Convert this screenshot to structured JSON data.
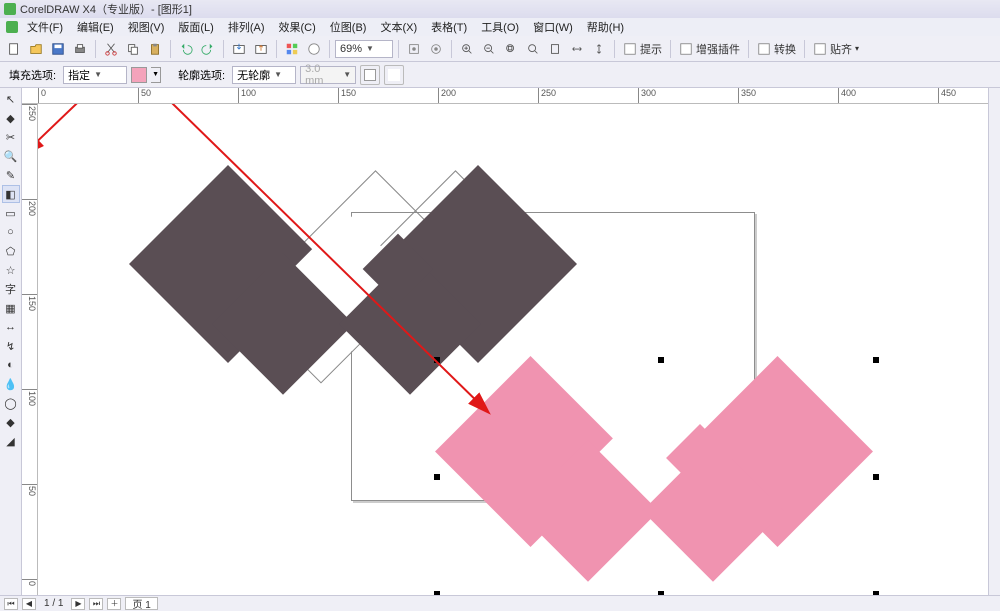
{
  "app": {
    "title": "CorelDRAW X4（专业版）- [图形1]"
  },
  "menu": {
    "file": "文件(F)",
    "edit": "编辑(E)",
    "view": "视图(V)",
    "layout": "版面(L)",
    "arrange": "排列(A)",
    "effects": "效果(C)",
    "bitmaps": "位图(B)",
    "text": "文本(X)",
    "table": "表格(T)",
    "tools": "工具(O)",
    "window": "窗口(W)",
    "help": "帮助(H)"
  },
  "toolbar1": {
    "zoom_value": "69%",
    "group_hints": "提示",
    "group_enhplugin": "增强插件",
    "group_convert": "转换",
    "group_align": "贴齐"
  },
  "propbar": {
    "fill_label": "填充选项:",
    "fill_option": "指定",
    "outline_label": "轮廓选项:",
    "outline_option": "无轮廓",
    "outline_width": "3.0 mm"
  },
  "ruler_h": [
    "0",
    "50",
    "100",
    "150",
    "200",
    "250",
    "300",
    "350",
    "400",
    "450"
  ],
  "ruler_v": [
    "250",
    "200",
    "150",
    "100",
    "50",
    "0"
  ],
  "status": {
    "page_of": "1 / 1",
    "page_tab": "页 1"
  },
  "shapes": {
    "dark_fill": "#5a4e54",
    "pink_fill": "#f093b0"
  },
  "tool_icons": [
    "pick",
    "shape",
    "crop",
    "zoom",
    "freehand",
    "smart",
    "rect",
    "ellipse",
    "poly",
    "basic",
    "text",
    "table2",
    "dim",
    "conn",
    "interactive",
    "eyedrop",
    "outline",
    "fill",
    "ifill"
  ]
}
